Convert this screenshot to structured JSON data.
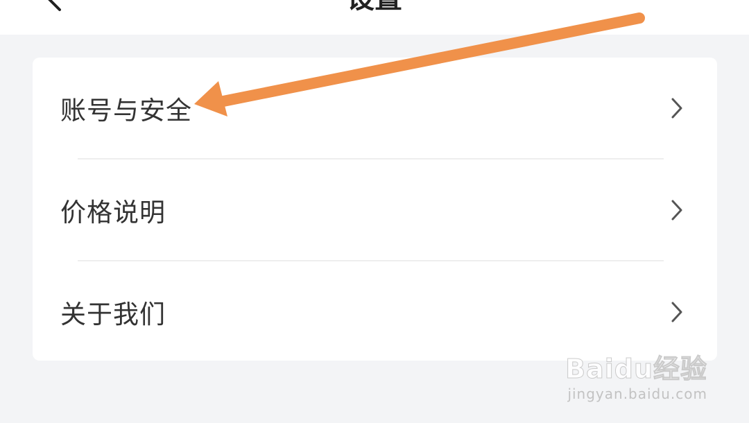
{
  "header": {
    "title": "设置",
    "back_icon": "chevron-left-icon"
  },
  "settings": {
    "items": [
      {
        "label": "账号与安全",
        "icon": "chevron-right-icon"
      },
      {
        "label": "价格说明",
        "icon": "chevron-right-icon"
      },
      {
        "label": "关于我们",
        "icon": "chevron-right-icon"
      }
    ]
  },
  "annotation": {
    "arrow_color": "#f0914a"
  },
  "watermark": {
    "logo_text": "Baidu经验",
    "url": "jingyan.baidu.com"
  },
  "colors": {
    "background": "#f3f4f6",
    "card": "#ffffff",
    "text": "#333333",
    "chevron": "#555555"
  }
}
